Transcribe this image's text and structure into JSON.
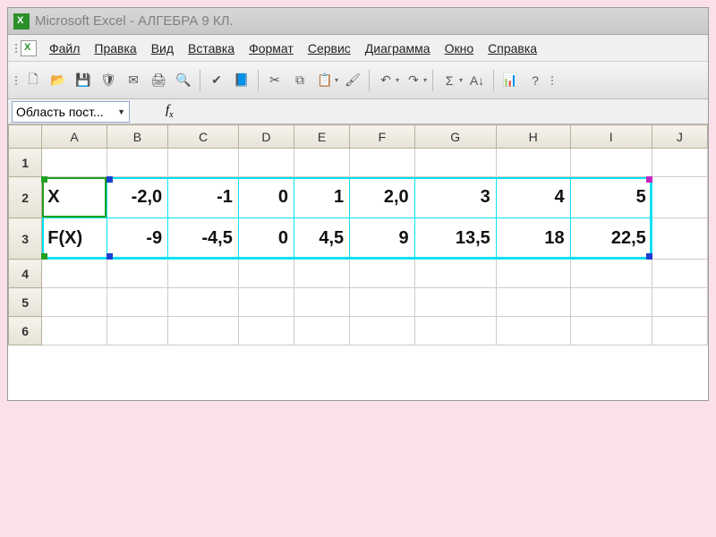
{
  "window": {
    "app_name": "Microsoft Excel",
    "doc_name": "АЛГЕБРА 9 КЛ."
  },
  "menu": {
    "file": "Файл",
    "edit": "Правка",
    "view": "Вид",
    "insert": "Вставка",
    "format": "Формат",
    "tools": "Сервис",
    "chart": "Диаграмма",
    "window": "Окно",
    "help": "Справка"
  },
  "toolbar_icons": {
    "new": "🗋",
    "open": "📂",
    "save": "💾",
    "perm": "🛡",
    "mail": "✉",
    "print": "🖨",
    "preview": "🔍",
    "spell": "✔",
    "research": "📘",
    "cut": "✂",
    "copy": "⧉",
    "paste": "📋",
    "fmtpaint": "🖌",
    "undo": "↶",
    "redo": "↷",
    "sum": "Σ",
    "sort": "A↓",
    "wizard": "📊",
    "help": "?"
  },
  "formula_bar": {
    "name_box": "Область пост...",
    "fx_label": "fx"
  },
  "columns": [
    "A",
    "B",
    "C",
    "D",
    "E",
    "F",
    "G",
    "H",
    "I",
    "J"
  ],
  "rows": [
    "1",
    "2",
    "3",
    "4",
    "5",
    "6"
  ],
  "data": {
    "r2": {
      "label": "X",
      "vals": [
        "-2,0",
        "-1",
        "0",
        "1",
        "2,0",
        "3",
        "4",
        "5"
      ]
    },
    "r3": {
      "label": "F(X)",
      "vals": [
        "-9",
        "-4,5",
        "0",
        "4,5",
        "9",
        "13,5",
        "18",
        "22,5"
      ]
    }
  }
}
